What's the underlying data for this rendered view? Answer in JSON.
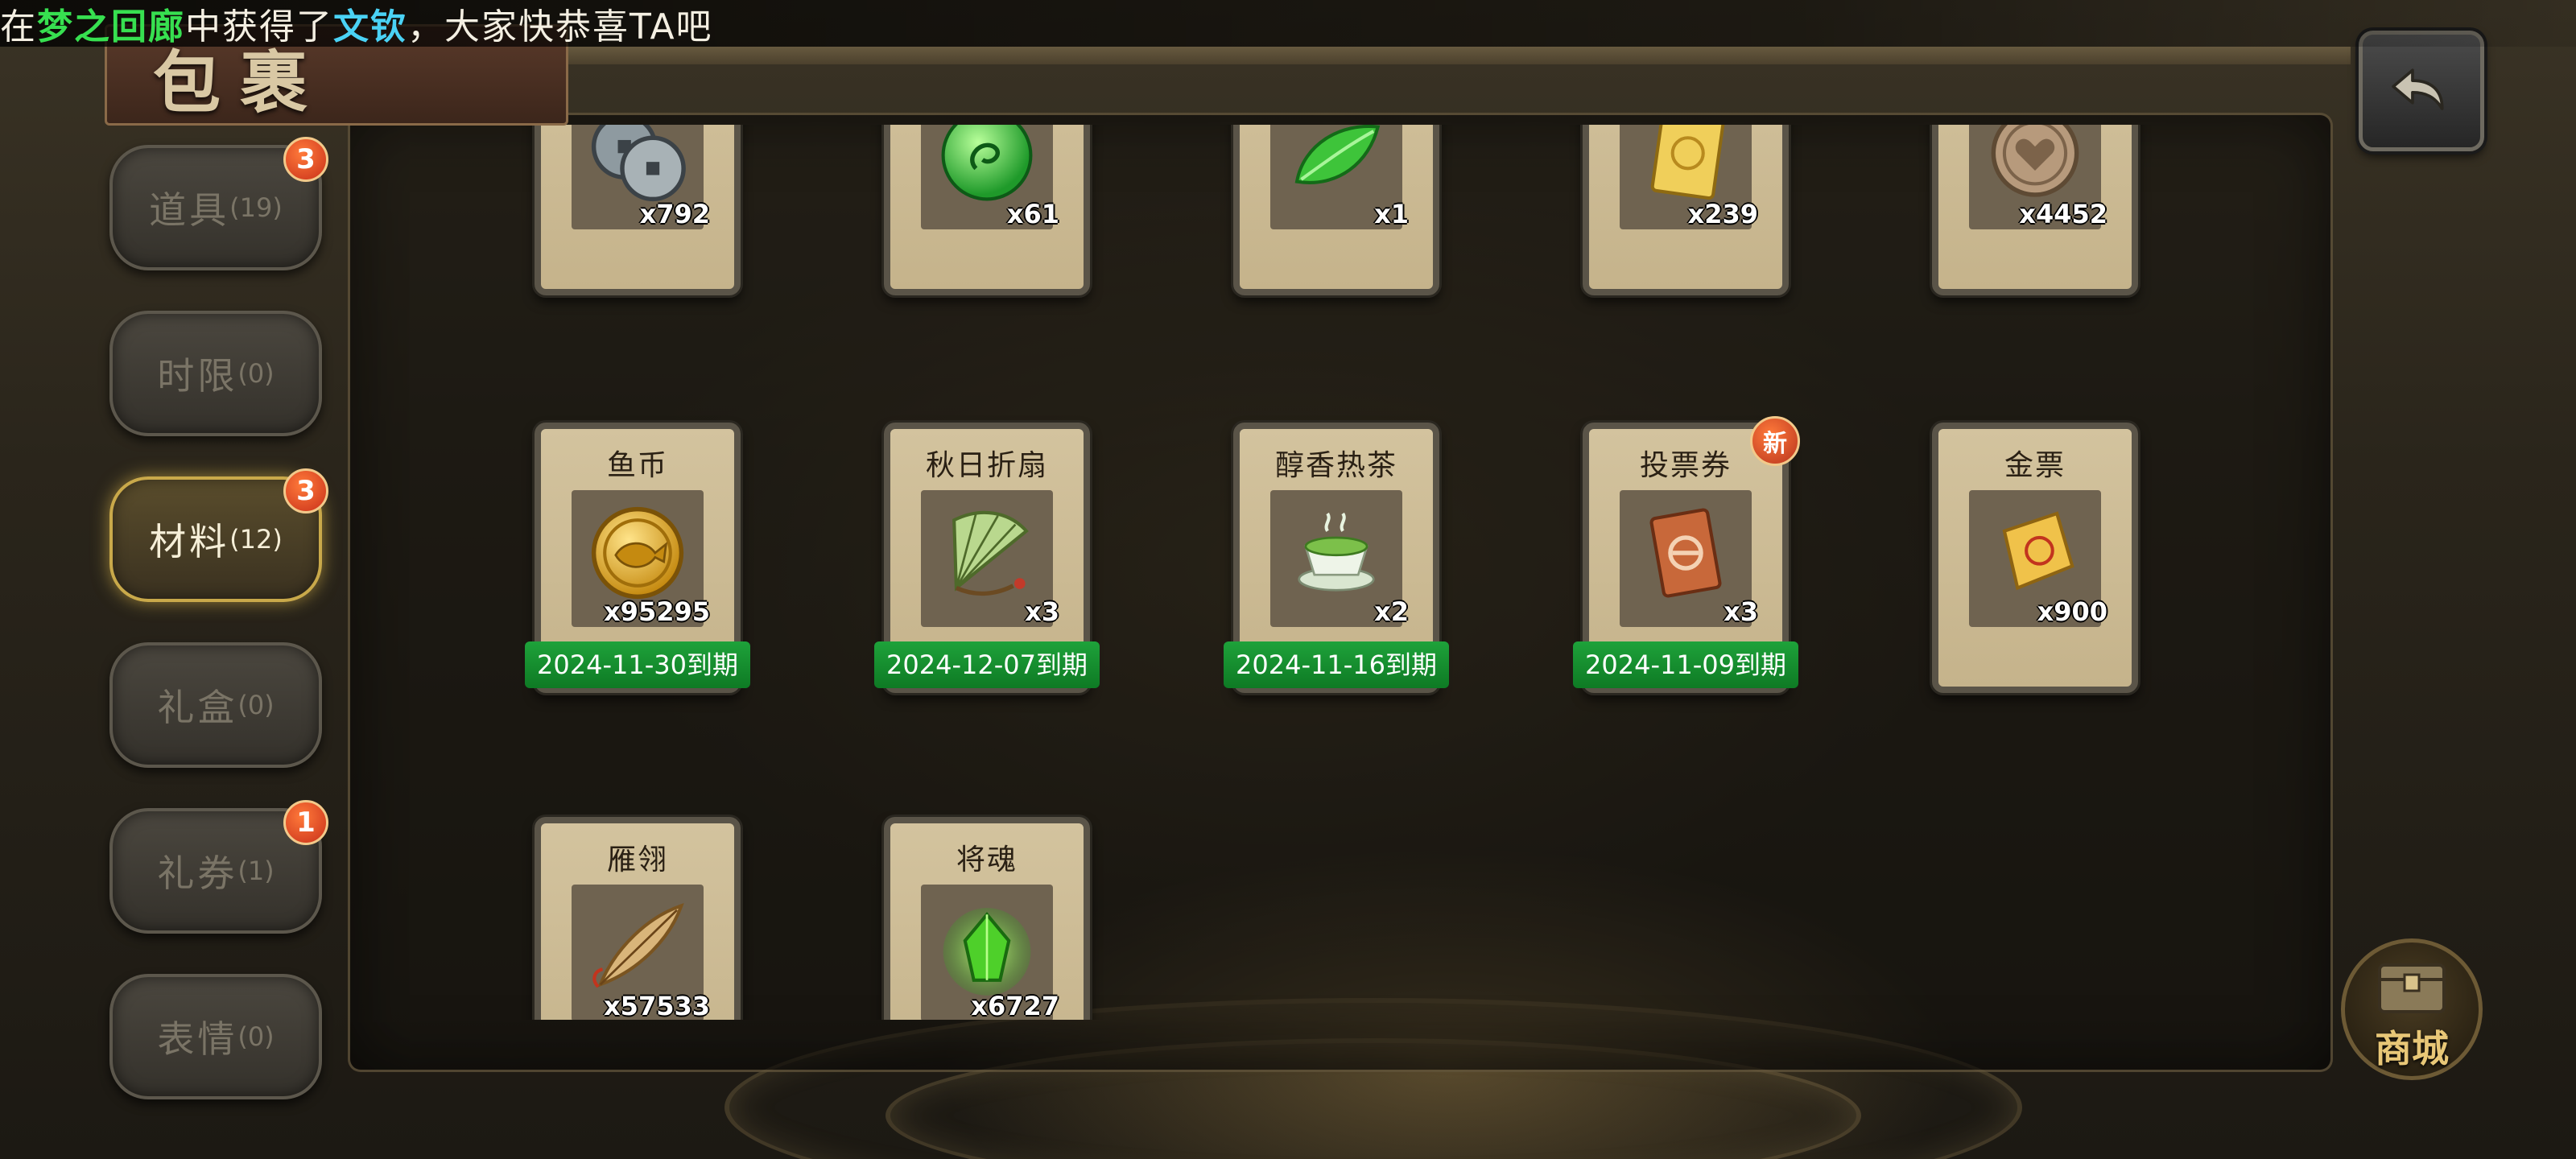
{
  "announcement": {
    "prefix": "在",
    "place": "梦之回廊",
    "middle": "中获得了",
    "item": "文钦",
    "suffix": "，大家快恭喜TA吧"
  },
  "header": {
    "title": "包裹",
    "back_icon": "return-arrow-icon"
  },
  "sidebar": {
    "tabs": [
      {
        "label": "道具",
        "count": "(19)",
        "badge": "3",
        "active": false
      },
      {
        "label": "时限",
        "count": "(0)",
        "badge": "",
        "active": false
      },
      {
        "label": "材料",
        "count": "(12)",
        "badge": "3",
        "active": true
      },
      {
        "label": "礼盒",
        "count": "(0)",
        "badge": "",
        "active": false
      },
      {
        "label": "礼券",
        "count": "(1)",
        "badge": "1",
        "active": false
      },
      {
        "label": "表情",
        "count": "(0)",
        "badge": "",
        "active": false
      }
    ]
  },
  "items": [
    {
      "name": "",
      "qty": "x792",
      "icon": "copper-coins-icon",
      "expiry": "",
      "new": ""
    },
    {
      "name": "",
      "qty": "x61",
      "icon": "green-orb-icon",
      "expiry": "",
      "new": ""
    },
    {
      "name": "",
      "qty": "x1",
      "icon": "green-leaf-icon",
      "expiry": "",
      "new": ""
    },
    {
      "name": "",
      "qty": "x239",
      "icon": "gold-card-icon",
      "expiry": "",
      "new": ""
    },
    {
      "name": "",
      "qty": "x4452",
      "icon": "heart-coin-icon",
      "expiry": "",
      "new": ""
    },
    {
      "name": "鱼币",
      "qty": "x95295",
      "icon": "fish-coin-icon",
      "expiry": "2024-11-30到期",
      "new": ""
    },
    {
      "name": "秋日折扇",
      "qty": "x3",
      "icon": "folding-fan-icon",
      "expiry": "2024-12-07到期",
      "new": ""
    },
    {
      "name": "醇香热茶",
      "qty": "x2",
      "icon": "tea-cup-icon",
      "expiry": "2024-11-16到期",
      "new": ""
    },
    {
      "name": "投票券",
      "qty": "x3",
      "icon": "vote-ticket-icon",
      "expiry": "2024-11-09到期",
      "new": "新"
    },
    {
      "name": "金票",
      "qty": "x900",
      "icon": "gold-scroll-icon",
      "expiry": "",
      "new": ""
    },
    {
      "name": "雁翎",
      "qty": "x57533",
      "icon": "feather-icon",
      "expiry": "",
      "new": ""
    },
    {
      "name": "将魂",
      "qty": "x6727",
      "icon": "green-spirit-icon",
      "expiry": "",
      "new": ""
    }
  ],
  "shop": {
    "label": "商城",
    "icon": "treasure-chest-icon"
  },
  "colors": {
    "accent_gold": "#c9a94a",
    "expiry_green": "#1ea23a",
    "badge_red": "#c9301a",
    "announce_green": "#37e050",
    "announce_cyan": "#4ad2f5"
  }
}
